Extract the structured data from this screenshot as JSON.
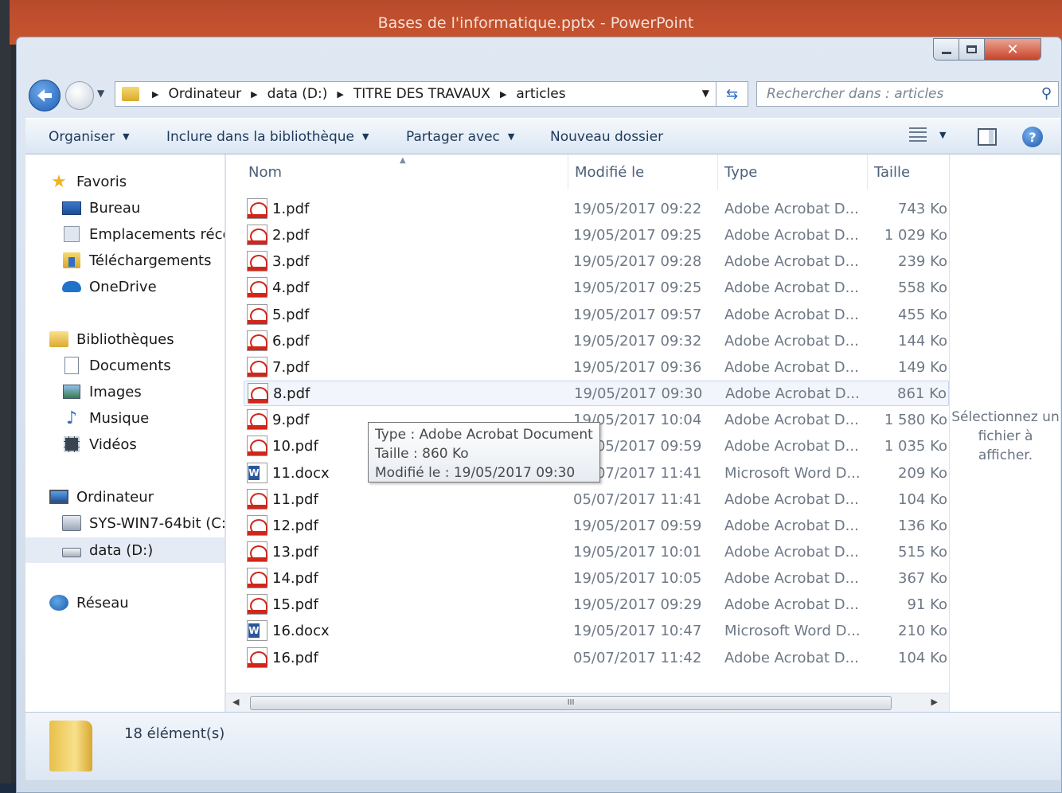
{
  "ppt": {
    "title": "Bases de l'informatique.pptx  -  PowerPoint"
  },
  "window_controls": {
    "minimize": "minimize",
    "maximize": "maximize",
    "close": "x"
  },
  "address": {
    "crumbs": [
      "Ordinateur",
      "data (D:)",
      "TITRE DES TRAVAUX",
      "articles"
    ]
  },
  "search": {
    "placeholder": "Rechercher dans : articles"
  },
  "toolbar": {
    "organize": "Organiser",
    "include": "Inclure dans la bibliothèque",
    "share": "Partager avec",
    "new_folder": "Nouveau dossier"
  },
  "nav": {
    "favorites": "Favoris",
    "desktop": "Bureau",
    "recent": "Emplacements récents",
    "downloads": "Téléchargements",
    "onedrive": "OneDrive",
    "libraries": "Bibliothèques",
    "documents": "Documents",
    "images": "Images",
    "music": "Musique",
    "videos": "Vidéos",
    "computer": "Ordinateur",
    "drive_c": "SYS-WIN7-64bit (C:)",
    "drive_d": "data (D:)",
    "network": "Réseau"
  },
  "columns": {
    "name": "Nom",
    "modified": "Modifié le",
    "type": "Type",
    "size": "Taille"
  },
  "files": [
    {
      "name": "1.pdf",
      "date": "19/05/2017 09:22",
      "type": "Adobe Acrobat D...",
      "size": "743 Ko",
      "kind": "pdf"
    },
    {
      "name": "2.pdf",
      "date": "19/05/2017 09:25",
      "type": "Adobe Acrobat D...",
      "size": "1 029 Ko",
      "kind": "pdf"
    },
    {
      "name": "3.pdf",
      "date": "19/05/2017 09:28",
      "type": "Adobe Acrobat D...",
      "size": "239 Ko",
      "kind": "pdf"
    },
    {
      "name": "4.pdf",
      "date": "19/05/2017 09:25",
      "type": "Adobe Acrobat D...",
      "size": "558 Ko",
      "kind": "pdf"
    },
    {
      "name": "5.pdf",
      "date": "19/05/2017 09:57",
      "type": "Adobe Acrobat D...",
      "size": "455 Ko",
      "kind": "pdf"
    },
    {
      "name": "6.pdf",
      "date": "19/05/2017 09:32",
      "type": "Adobe Acrobat D...",
      "size": "144 Ko",
      "kind": "pdf"
    },
    {
      "name": "7.pdf",
      "date": "19/05/2017 09:36",
      "type": "Adobe Acrobat D...",
      "size": "149 Ko",
      "kind": "pdf"
    },
    {
      "name": "8.pdf",
      "date": "19/05/2017 09:30",
      "type": "Adobe Acrobat D...",
      "size": "861 Ko",
      "kind": "pdf"
    },
    {
      "name": "9.pdf",
      "date": "19/05/2017 10:04",
      "type": "Adobe Acrobat D...",
      "size": "1 580 Ko",
      "kind": "pdf"
    },
    {
      "name": "10.pdf",
      "date": "19/05/2017 09:59",
      "type": "Adobe Acrobat D...",
      "size": "1 035 Ko",
      "kind": "pdf"
    },
    {
      "name": "11.docx",
      "date": "05/07/2017 11:41",
      "type": "Microsoft Word D...",
      "size": "209 Ko",
      "kind": "docx"
    },
    {
      "name": "11.pdf",
      "date": "05/07/2017 11:41",
      "type": "Adobe Acrobat D...",
      "size": "104 Ko",
      "kind": "pdf"
    },
    {
      "name": "12.pdf",
      "date": "19/05/2017 09:59",
      "type": "Adobe Acrobat D...",
      "size": "136 Ko",
      "kind": "pdf"
    },
    {
      "name": "13.pdf",
      "date": "19/05/2017 10:01",
      "type": "Adobe Acrobat D...",
      "size": "515 Ko",
      "kind": "pdf"
    },
    {
      "name": "14.pdf",
      "date": "19/05/2017 10:05",
      "type": "Adobe Acrobat D...",
      "size": "367 Ko",
      "kind": "pdf"
    },
    {
      "name": "15.pdf",
      "date": "19/05/2017 09:29",
      "type": "Adobe Acrobat D...",
      "size": "91 Ko",
      "kind": "pdf"
    },
    {
      "name": "16.docx",
      "date": "19/05/2017 10:47",
      "type": "Microsoft Word D...",
      "size": "210 Ko",
      "kind": "docx"
    },
    {
      "name": "16.pdf",
      "date": "05/07/2017 11:42",
      "type": "Adobe Acrobat D...",
      "size": "104 Ko",
      "kind": "pdf"
    }
  ],
  "tooltip": {
    "type": "Type : Adobe Acrobat Document",
    "size": "Taille : 860 Ko",
    "modified": "Modifié le : 19/05/2017 09:30"
  },
  "preview": {
    "message": "Sélectionnez un fichier à afficher."
  },
  "scroll": {
    "thumb_grip": "III"
  },
  "status": {
    "count": "18 élément(s)"
  }
}
